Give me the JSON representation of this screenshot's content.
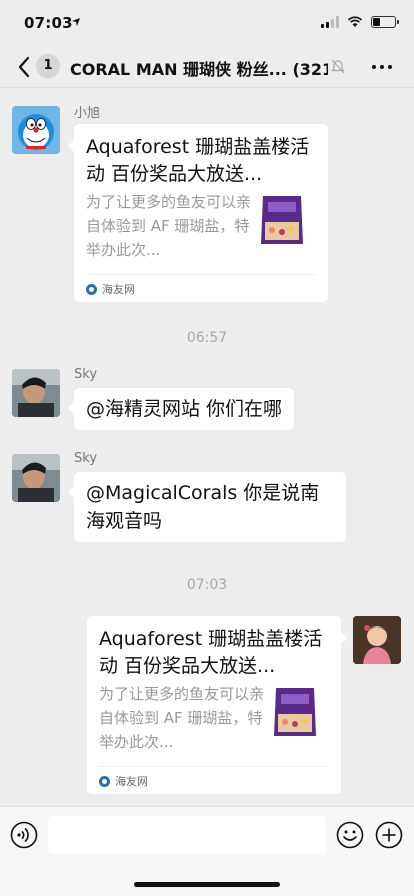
{
  "status_bar": {
    "time": "07:03"
  },
  "header": {
    "back_badge": "1",
    "title": "CORAL MAN 珊瑚侠 粉丝... (321)"
  },
  "messages": {
    "m1": {
      "sender": "小旭",
      "card_title": "Aquaforest 珊瑚盐盖楼活动 百份奖品大放送...",
      "card_desc": "为了让更多的鱼友可以亲自体验到 AF 珊瑚盐，特举办此次...",
      "card_source": "海友网"
    },
    "time1": "06:57",
    "m2": {
      "sender": "Sky",
      "text": "@海精灵网站 你们在哪"
    },
    "m3": {
      "sender": "Sky",
      "text": "@MagicalCorals 你是说南海观音吗"
    },
    "time2": "07:03",
    "m4": {
      "card_title": "Aquaforest 珊瑚盐盖楼活动 百份奖品大放送...",
      "card_desc": "为了让更多的鱼友可以亲自体验到 AF 珊瑚盐，特举办此次...",
      "card_source": "海友网"
    }
  },
  "input_bar": {
    "placeholder": ""
  },
  "colors": {
    "background": "#ededed",
    "bubble": "#ffffff",
    "muted_text": "#999999"
  }
}
